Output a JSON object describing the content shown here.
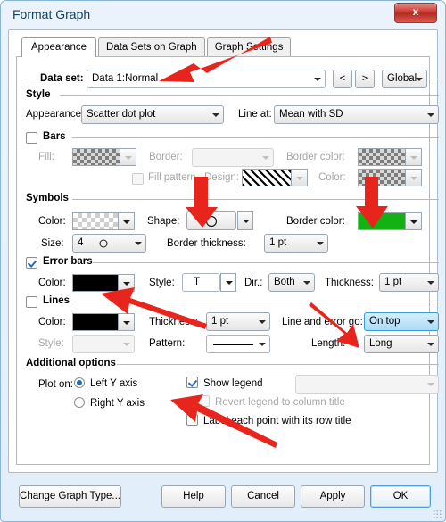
{
  "window": {
    "title": "Format Graph",
    "close_label": "x"
  },
  "tabs": [
    {
      "label": "Appearance",
      "active": true
    },
    {
      "label": "Data Sets on Graph",
      "active": false
    },
    {
      "label": "Graph Settings",
      "active": false
    }
  ],
  "dataset": {
    "label": "Data set:",
    "value": "Data 1:Normal",
    "prev_label": "<",
    "next_label": ">",
    "scope_value": "Global"
  },
  "style": {
    "group_label": "Style",
    "appearance_label": "Appearance:",
    "appearance_value": "Scatter dot plot",
    "line_at_label": "Line at:",
    "line_at_value": "Mean with SD"
  },
  "bars": {
    "group_label": "Bars",
    "checked": false,
    "fill_label": "Fill:",
    "border_label": "Border:",
    "border_value": "",
    "border_color_label": "Border color:",
    "fill_pattern_label": "Fill pattern",
    "fill_pattern_checked": false,
    "design_label": "Design:",
    "color_label": "Color:"
  },
  "symbols": {
    "group_label": "Symbols",
    "color_label": "Color:",
    "color_value": "transparent",
    "shape_label": "Shape:",
    "shape_value": "circle",
    "size_label": "Size:",
    "size_value": "4",
    "border_color_label": "Border color:",
    "border_color_value": "#12b212",
    "border_thickness_label": "Border thickness:",
    "border_thickness_value": "1 pt"
  },
  "error_bars": {
    "group_label": "Error bars",
    "checked": true,
    "color_label": "Color:",
    "color_value": "#000000",
    "style_label": "Style:",
    "style_value": "T",
    "dir_label": "Dir.:",
    "dir_value": "Both",
    "thickness_label": "Thickness:",
    "thickness_value": "1 pt"
  },
  "lines": {
    "group_label": "Lines",
    "checked": false,
    "color_label": "Color:",
    "color_value": "#000000",
    "thickness_label": "Thickness:",
    "thickness_value": "1 pt",
    "line_error_go_label": "Line and error go:",
    "line_error_go_value": "On top",
    "style_label": "Style:",
    "style_value": "",
    "pattern_label": "Pattern:",
    "pattern_value": "solid",
    "length_label": "Length:",
    "length_value": "Long"
  },
  "additional": {
    "group_label": "Additional options",
    "plot_on_label": "Plot on:",
    "left_axis_label": "Left Y axis",
    "left_axis_selected": true,
    "right_axis_label": "Right  Y axis",
    "right_axis_selected": false,
    "show_legend_label": "Show legend",
    "show_legend_checked": true,
    "legend_value": "",
    "revert_legend_label": "Revert legend to column title",
    "revert_legend_checked": false,
    "label_each_point_label": "Label each point with its row title",
    "label_each_point_checked": false
  },
  "footer": {
    "change_graph_type": "Change Graph Type...",
    "help": "Help",
    "cancel": "Cancel",
    "apply": "Apply",
    "ok": "OK"
  },
  "annotations": {
    "arrow_color": "#e8251c",
    "arrows": [
      {
        "name": "arrow-to-dataset",
        "target": "dataset field"
      },
      {
        "name": "arrow-to-shape",
        "target": "symbol shape dropdown"
      },
      {
        "name": "arrow-to-symbol-border-color",
        "target": "symbol border color swatch"
      },
      {
        "name": "arrow-to-errorbar-color",
        "target": "error bar color swatch"
      },
      {
        "name": "arrow-to-line-error-go",
        "target": "line and error go dropdown"
      },
      {
        "name": "arrow-to-show-legend",
        "target": "show legend checkbox"
      }
    ]
  }
}
